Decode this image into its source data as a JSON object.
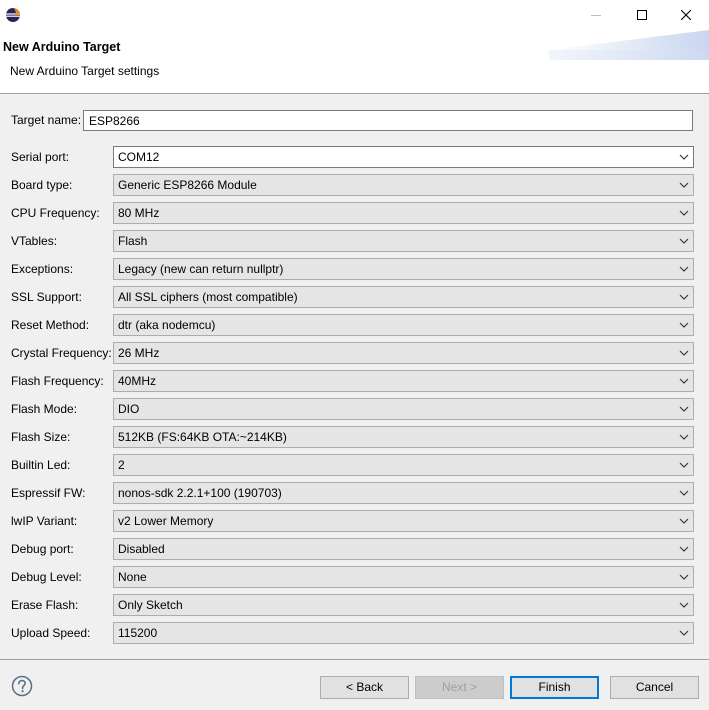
{
  "window": {
    "icon": "eclipse-icon",
    "controls": [
      "minimize-icon",
      "maximize-icon",
      "close-icon"
    ]
  },
  "header": {
    "title": "New Arduino Target",
    "subtitle": "New Arduino Target settings"
  },
  "target_name": {
    "label": "Target name:",
    "value": "ESP8266"
  },
  "settings": [
    {
      "label": "Serial port:",
      "value": "COM12"
    },
    {
      "label": "Board type:",
      "value": "Generic ESP8266 Module"
    },
    {
      "label": "CPU Frequency:",
      "value": "80 MHz"
    },
    {
      "label": "VTables:",
      "value": "Flash"
    },
    {
      "label": "Exceptions:",
      "value": "Legacy (new can return nullptr)"
    },
    {
      "label": "SSL Support:",
      "value": "All SSL ciphers (most compatible)"
    },
    {
      "label": "Reset Method:",
      "value": "dtr (aka nodemcu)"
    },
    {
      "label": "Crystal Frequency:",
      "value": "26 MHz"
    },
    {
      "label": "Flash Frequency:",
      "value": "40MHz"
    },
    {
      "label": "Flash Mode:",
      "value": "DIO"
    },
    {
      "label": "Flash Size:",
      "value": "512KB (FS:64KB OTA:~214KB)"
    },
    {
      "label": "Builtin Led:",
      "value": "2"
    },
    {
      "label": "Espressif FW:",
      "value": "nonos-sdk 2.2.1+100 (190703)"
    },
    {
      "label": "lwIP Variant:",
      "value": "v2 Lower Memory"
    },
    {
      "label": "Debug port:",
      "value": "Disabled"
    },
    {
      "label": "Debug Level:",
      "value": "None"
    },
    {
      "label": "Erase Flash:",
      "value": "Only Sketch"
    },
    {
      "label": "Upload Speed:",
      "value": "115200"
    }
  ],
  "footer": {
    "help_icon": "help-icon",
    "back_label": "< Back",
    "next_label": "Next >",
    "finish_label": "Finish",
    "cancel_label": "Cancel"
  },
  "colors": {
    "accent": "#0078d7",
    "panel_background": "#f0f0f0",
    "disabled_text": "#a0a0a0"
  }
}
